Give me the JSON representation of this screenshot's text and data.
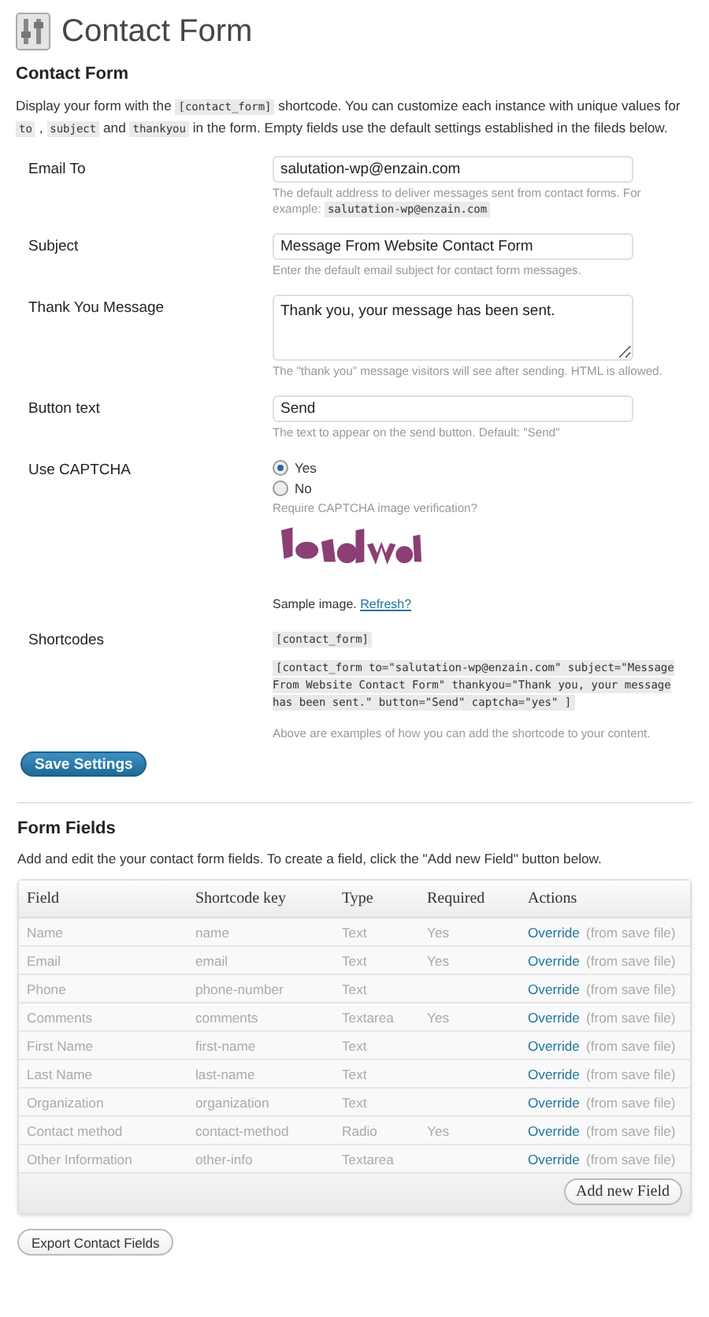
{
  "page": {
    "title": "Contact Form"
  },
  "settings": {
    "heading": "Contact Form",
    "intro": [
      {
        "kind": "text",
        "text": "Display your form with the "
      },
      {
        "kind": "code",
        "text": "[contact_form]"
      },
      {
        "kind": "text",
        "text": " shortcode. You can customize each instance with unique values for "
      },
      {
        "kind": "code",
        "text": "to"
      },
      {
        "kind": "text",
        "text": " , "
      },
      {
        "kind": "code",
        "text": "subject"
      },
      {
        "kind": "text",
        "text": " and "
      },
      {
        "kind": "code",
        "text": "thankyou"
      },
      {
        "kind": "text",
        "text": " in the form. Empty fields use the default settings established in the fileds below."
      }
    ],
    "rows": [
      {
        "kind": "text",
        "label": "Email To",
        "value": "salutation-wp@enzain.com",
        "help": [
          {
            "kind": "text",
            "text": "The default address to deliver messages sent from contact forms. For example: "
          },
          {
            "kind": "code",
            "text": "salutation-wp@enzain.com"
          }
        ]
      },
      {
        "kind": "text",
        "label": "Subject",
        "value": "Message From Website Contact Form",
        "help": [
          {
            "kind": "text",
            "text": "Enter the default email subject for contact form messages."
          }
        ]
      },
      {
        "kind": "textarea",
        "label": "Thank You Message",
        "value": "Thank you, your message has been sent.",
        "help": [
          {
            "kind": "text",
            "text": "The \"thank you\" message visitors will see after sending. HTML is allowed."
          }
        ]
      },
      {
        "kind": "text",
        "label": "Button text",
        "value": "Send",
        "help": [
          {
            "kind": "text",
            "text": "The text to appear on the send button. Default: \"Send\""
          }
        ]
      },
      {
        "kind": "radio",
        "label": "Use CAPTCHA",
        "options": [
          {
            "label": "Yes",
            "selected": true
          },
          {
            "label": "No",
            "selected": false
          }
        ],
        "help": [
          {
            "kind": "text",
            "text": "Require CAPTCHA image verification?"
          }
        ],
        "sample": {
          "kind": "picture"
        },
        "caption": "Sample image.",
        "link": "Refresh?"
      },
      {
        "kind": "shortcodes",
        "label": "Shortcodes",
        "codes": [
          "[contact_form]",
          "[contact_form to=\"salutation-wp@enzain.com\" subject=\"Message From Website Contact Form\" thankyou=\"Thank you, your message has been sent.\" button=\"Send\" captcha=\"yes\" ]"
        ],
        "help": [
          {
            "kind": "text",
            "text": "Above are examples of how you can add the shortcode to your content."
          }
        ]
      }
    ],
    "save_button": "Save Settings"
  },
  "fields": {
    "heading": "Form Fields",
    "intro": "Add and edit the your contact form fields. To create a field, click the \"Add new Field\" button below.",
    "columns": [
      "Field",
      "Shortcode key",
      "Type",
      "Required",
      "Actions"
    ],
    "rows": [
      {
        "field": "Name",
        "key": "name",
        "type": "Text",
        "required": "Yes",
        "action": "Override",
        "note": "(from save file)"
      },
      {
        "field": "Email",
        "key": "email",
        "type": "Text",
        "required": "Yes",
        "action": "Override",
        "note": "(from save file)"
      },
      {
        "field": "Phone",
        "key": "phone-number",
        "type": "Text",
        "action": "Override",
        "note": "(from save file)"
      },
      {
        "field": "Comments",
        "key": "comments",
        "type": "Textarea",
        "required": "Yes",
        "action": "Override",
        "note": "(from save file)"
      },
      {
        "field": "First Name",
        "key": "first-name",
        "type": "Text",
        "action": "Override",
        "note": "(from save file)"
      },
      {
        "field": "Last Name",
        "key": "last-name",
        "type": "Text",
        "action": "Override",
        "note": "(from save file)"
      },
      {
        "field": "Organization",
        "key": "organization",
        "type": "Text",
        "action": "Override",
        "note": "(from save file)"
      },
      {
        "field": "Contact method",
        "key": "contact-method",
        "type": "Radio",
        "required": "Yes",
        "action": "Override",
        "note": "(from save file)"
      },
      {
        "field": "Other Information",
        "key": "other-info",
        "type": "Textarea",
        "action": "Override",
        "note": "(from save file)"
      }
    ],
    "add_button": "Add new Field"
  },
  "export_button": "Export Contact Fields"
}
